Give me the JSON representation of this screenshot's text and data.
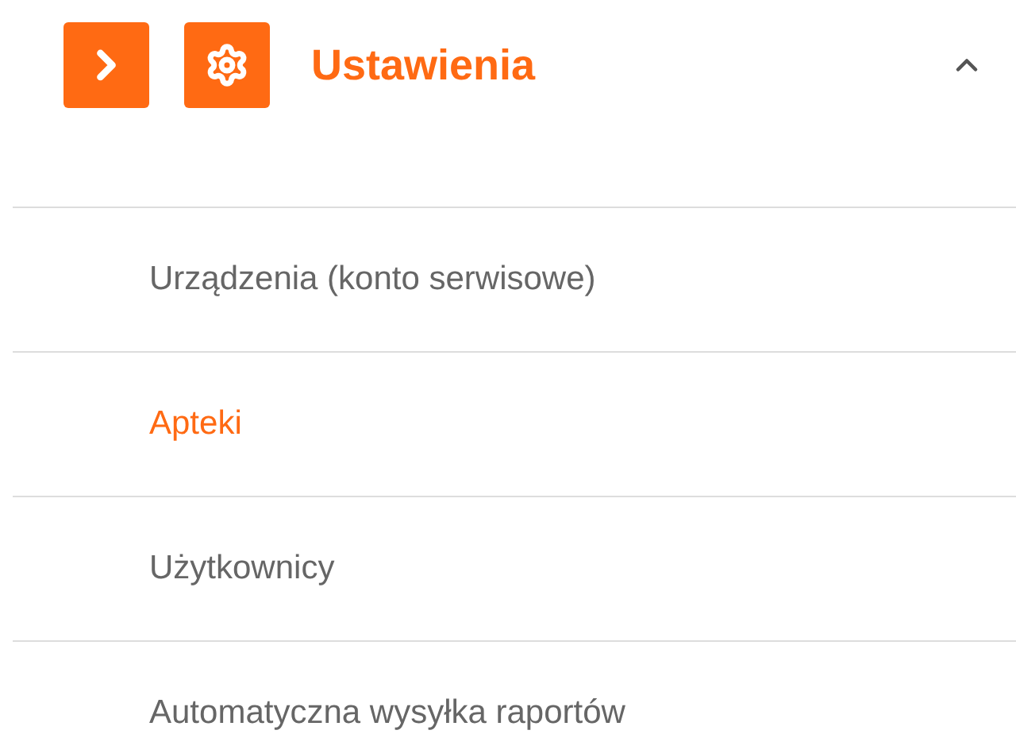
{
  "header": {
    "title": "Ustawienia",
    "expanded": true
  },
  "items": [
    {
      "label": "Urządzenia (konto serwisowe)",
      "selected": false
    },
    {
      "label": "Apteki",
      "selected": true
    },
    {
      "label": "Użytkownicy",
      "selected": false
    },
    {
      "label": "Automatyczna wysyłka raportów",
      "selected": false
    }
  ]
}
